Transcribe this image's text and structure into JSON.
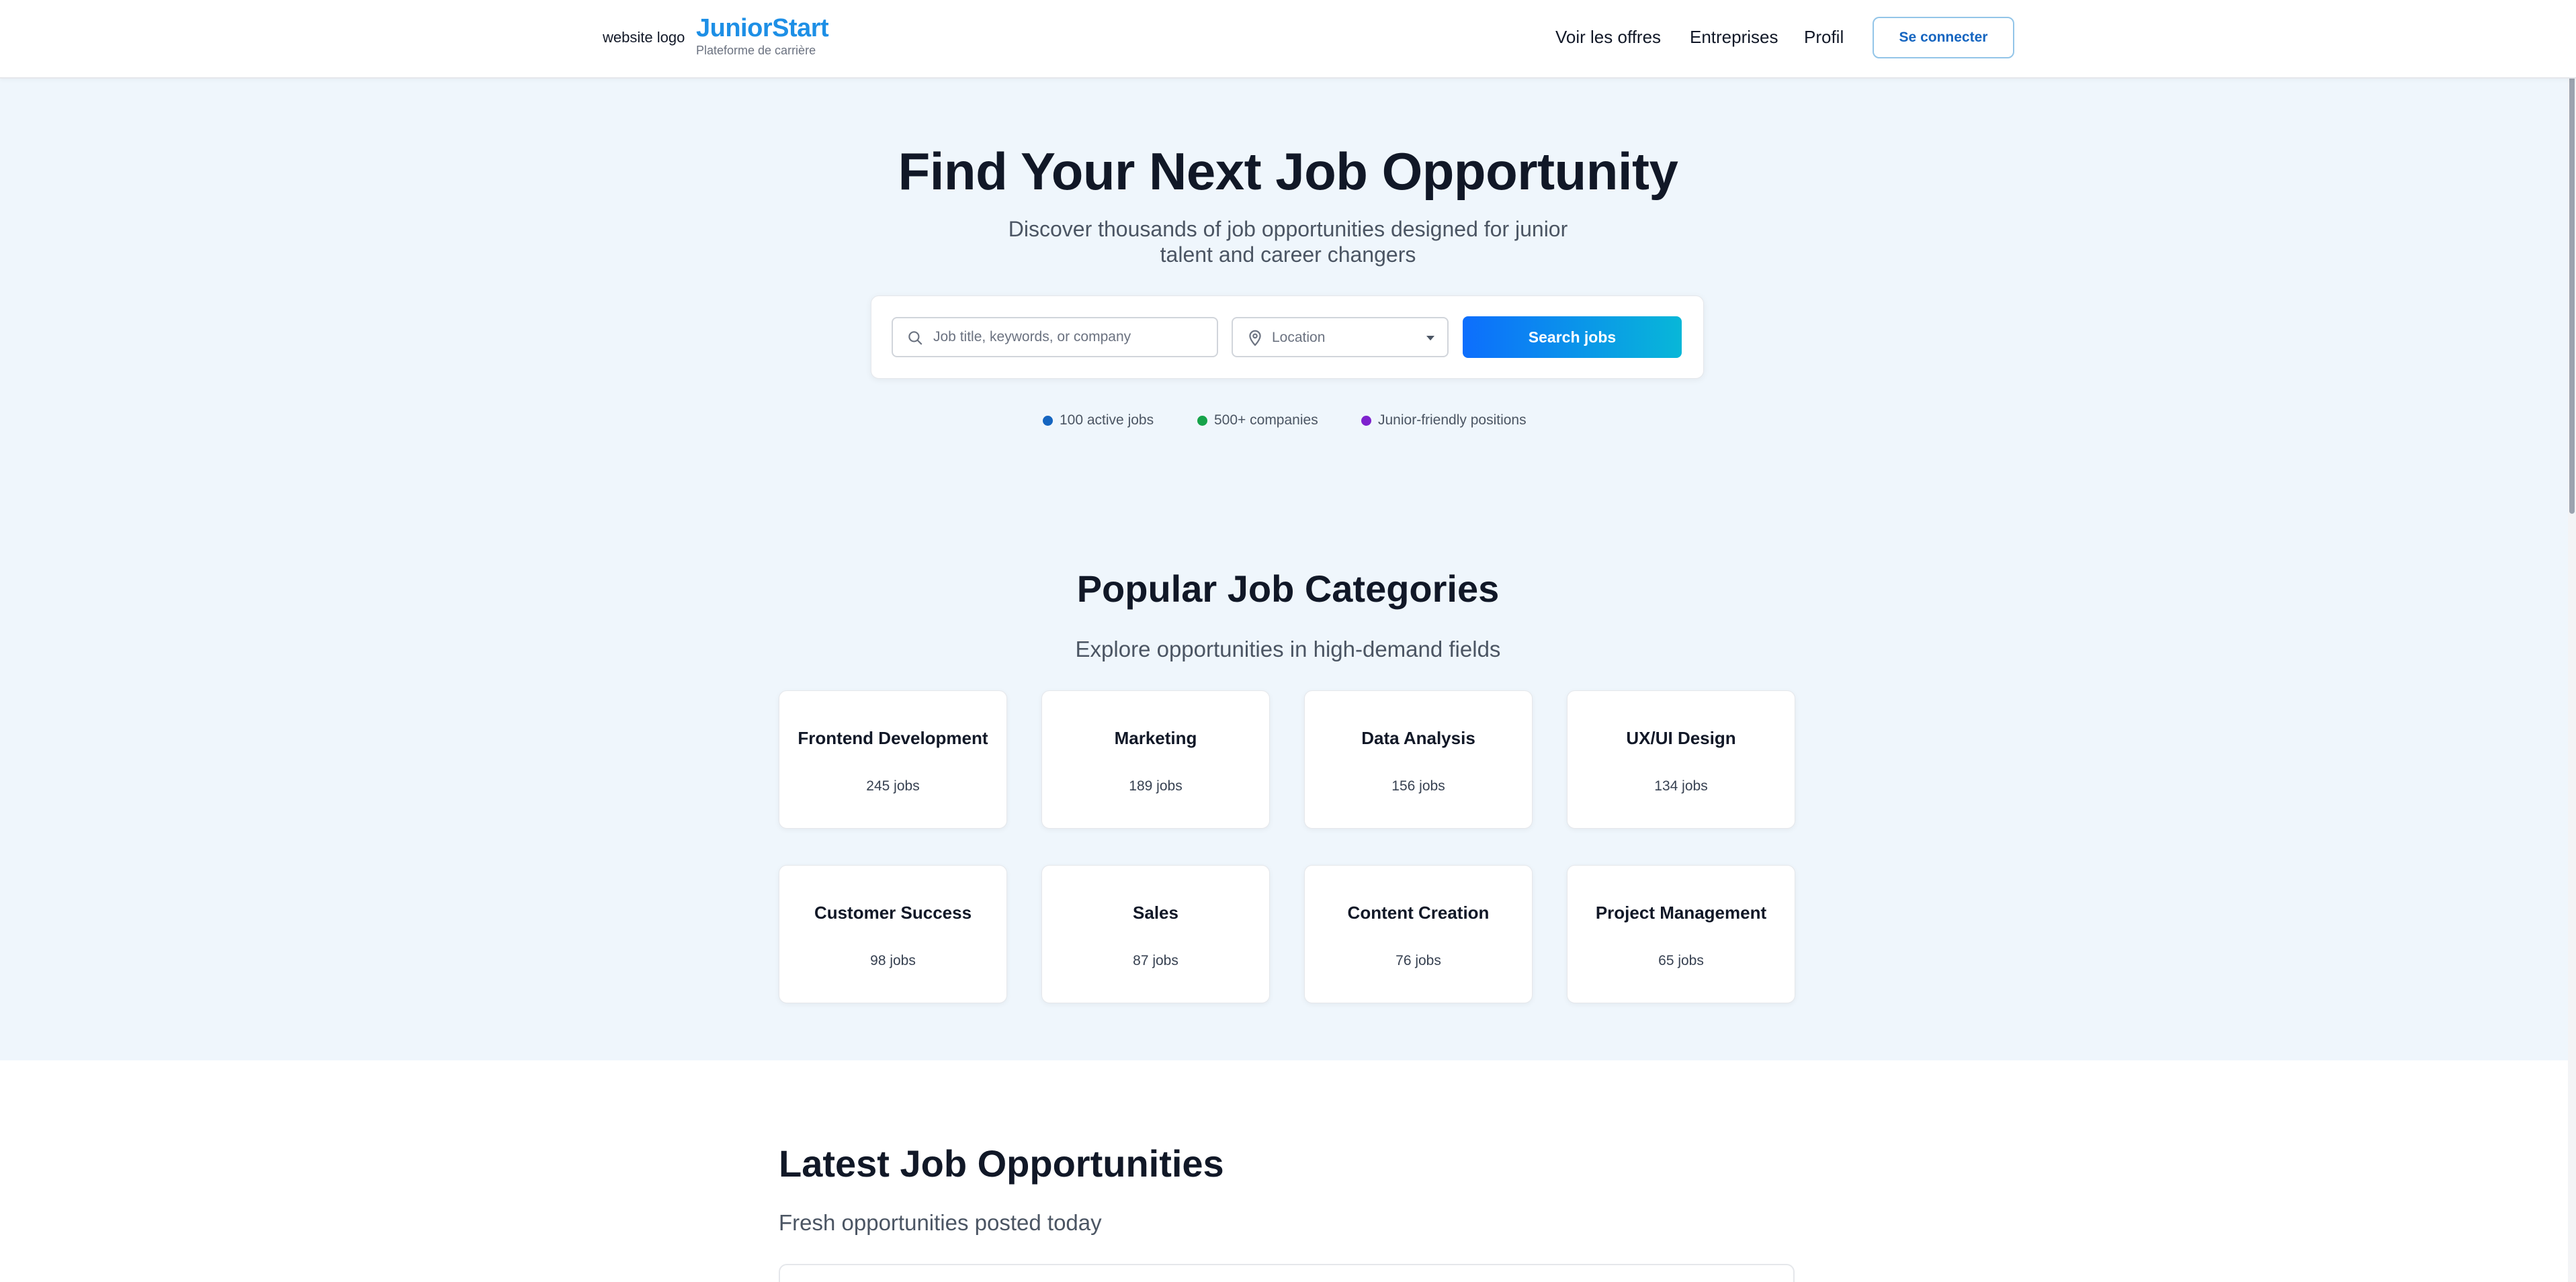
{
  "header": {
    "logo_alt": "website logo",
    "brand_name": "JuniorStart",
    "brand_tagline": "Plateforme de carrière",
    "nav": [
      "Voir les offres",
      "Entreprises",
      "Profil"
    ],
    "login_label": "Se connecter"
  },
  "hero": {
    "title": "Find Your Next Job Opportunity",
    "subtitle": "Discover thousands of job opportunities designed for junior talent and career changers",
    "search": {
      "keyword_placeholder": "Job title, keywords, or company",
      "location_placeholder": "Location",
      "button_label": "Search jobs"
    },
    "stats": [
      {
        "label": "100 active jobs",
        "color": "#1565c0"
      },
      {
        "label": "500+ companies",
        "color": "#16a34a"
      },
      {
        "label": "Junior-friendly positions",
        "color": "#7e22ce"
      }
    ]
  },
  "categories": {
    "title": "Popular Job Categories",
    "subtitle": "Explore opportunities in high-demand fields",
    "items": [
      {
        "name": "Frontend Development",
        "count": "245 jobs"
      },
      {
        "name": "Marketing",
        "count": "189 jobs"
      },
      {
        "name": "Data Analysis",
        "count": "156 jobs"
      },
      {
        "name": "UX/UI Design",
        "count": "134 jobs"
      },
      {
        "name": "Customer Success",
        "count": "98 jobs"
      },
      {
        "name": "Sales",
        "count": "87 jobs"
      },
      {
        "name": "Content Creation",
        "count": "76 jobs"
      },
      {
        "name": "Project Management",
        "count": "65 jobs"
      }
    ]
  },
  "latest": {
    "title": "Latest Job Opportunities",
    "subtitle": "Fresh opportunities posted today"
  },
  "colors": {
    "brand": "#1d8fe6",
    "band_background": "#eff6fc",
    "search_button_gradient_start": "#0d6efd",
    "search_button_gradient_end": "#08b7d8"
  },
  "icons": {
    "search": "search-icon",
    "location": "map-pin-icon",
    "dropdown": "caret-down-icon"
  }
}
